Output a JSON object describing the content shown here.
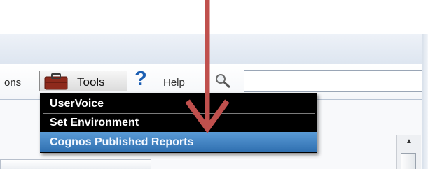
{
  "toolbar": {
    "truncated_prev_label": "ons",
    "tools_label": "Tools",
    "tools_icon": "toolbox-icon",
    "help_label": "Help",
    "help_icon": "help-question-icon",
    "search_icon": "magnifier-icon",
    "search_value": ""
  },
  "tools_menu": {
    "items": [
      {
        "label": "UserVoice"
      },
      {
        "label": "Set Environment"
      },
      {
        "label": "Cognos Published Reports",
        "selected": true
      }
    ]
  },
  "annotation": {
    "arrow_color": "#c0504d"
  },
  "colors": {
    "menu_bg": "#000000",
    "selected": "#3b80c4",
    "help_icon": "#1c5fb3"
  }
}
